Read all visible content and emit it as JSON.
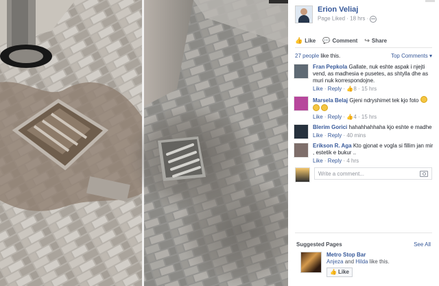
{
  "post": {
    "author": "Erion Veliaj",
    "meta": "Page Liked · 18 hrs ·"
  },
  "actions": {
    "like": "Like",
    "comment": "Comment",
    "share": "Share"
  },
  "likes": {
    "count": "27 people",
    "suffix": " like this.",
    "sort": "Top Comments ▾"
  },
  "comments": [
    {
      "name": "Fran Pepkola",
      "text": "Gallate, nuk eshte aspak i njejti vend, as madhesia e pusetes, as shtylla dhe as muri nuk korrespondojne.",
      "like": "Like",
      "reply": "Reply",
      "reactions": "8",
      "time": "15 hrs",
      "avatar_color": "#5f6a74"
    },
    {
      "name": "Marsela Belaj",
      "text": "Gjeni ndryshimet tek kjo foto",
      "like": "Like",
      "reply": "Reply",
      "reactions": "4",
      "time": "15 hrs",
      "avatar_color": "#b7479c"
    },
    {
      "name": "Blerim Gorici",
      "text": "hahahhahhaha kjo eshte e madhe",
      "like": "Like",
      "reply": "Reply",
      "time": "40 mins",
      "avatar_color": "#26313d"
    },
    {
      "name": "Erikson R. Aga",
      "text": "Kto gjonat e vogla si fillim jan mir , estetik e bukur ..",
      "like": "Like",
      "reply": "Reply",
      "time": "4 hrs",
      "avatar_color": "#7e6e6a"
    }
  ],
  "write_comment": {
    "placeholder": "Write a comment..."
  },
  "suggested": {
    "title": "Suggested Pages",
    "see_all": "See All",
    "page_name": "Metro Stop Bar",
    "likers_a": "Anjeza",
    "likers_and": " and ",
    "likers_b": "Hilda",
    "likers_suffix": " like this.",
    "like_button": "Like"
  }
}
